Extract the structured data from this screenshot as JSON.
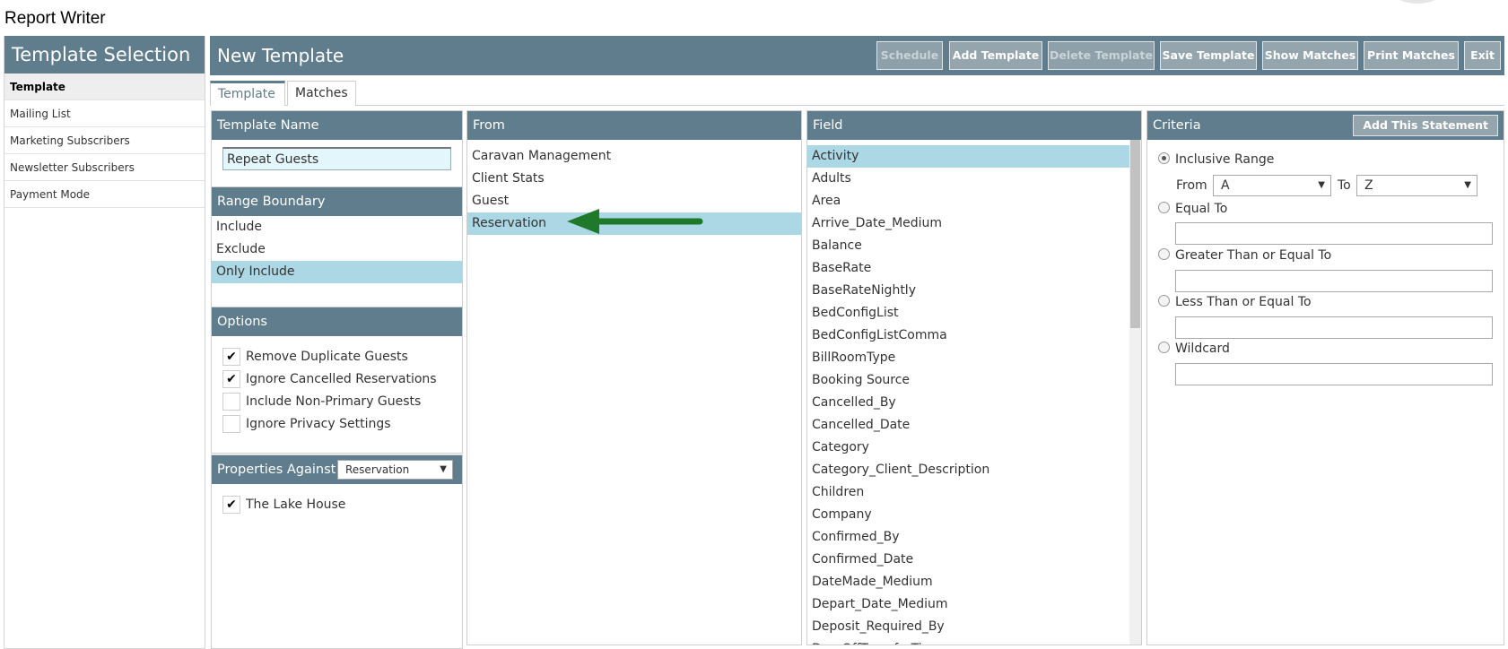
{
  "app": {
    "title": "Report Writer"
  },
  "sidebar": {
    "title": "Template Selection",
    "items": [
      {
        "label": "Template",
        "active": true
      },
      {
        "label": "Mailing List"
      },
      {
        "label": "Marketing Subscribers"
      },
      {
        "label": "Newsletter Subscribers"
      },
      {
        "label": "Payment Mode"
      }
    ]
  },
  "header": {
    "title": "New Template",
    "buttons": {
      "schedule": "Schedule",
      "add_template": "Add Template",
      "delete_template": "Delete Template",
      "save_template": "Save Template",
      "show_matches": "Show Matches",
      "print_matches": "Print Matches",
      "exit": "Exit"
    }
  },
  "tabs": {
    "template": "Template",
    "matches": "Matches"
  },
  "template_name": {
    "header": "Template Name",
    "value": "Repeat Guests"
  },
  "range_boundary": {
    "header": "Range Boundary",
    "items": [
      "Include",
      "Exclude",
      "Only Include"
    ],
    "selected": "Only Include"
  },
  "options": {
    "header": "Options",
    "items": [
      {
        "label": "Remove Duplicate Guests",
        "checked": true
      },
      {
        "label": "Ignore Cancelled Reservations",
        "checked": true
      },
      {
        "label": "Include Non-Primary Guests",
        "checked": false
      },
      {
        "label": "Ignore Privacy Settings",
        "checked": false
      }
    ]
  },
  "properties": {
    "header": "Properties Against",
    "selected": "Reservation",
    "items": [
      {
        "label": "The Lake House",
        "checked": true
      }
    ]
  },
  "from": {
    "header": "From",
    "items": [
      "Caravan Management",
      "Client Stats",
      "Guest",
      "Reservation"
    ],
    "selected": "Reservation"
  },
  "field": {
    "header": "Field",
    "selected": "Activity",
    "items": [
      "Activity",
      "Adults",
      "Area",
      "Arrive_Date_Medium",
      "Balance",
      "BaseRate",
      "BaseRateNightly",
      "BedConfigList",
      "BedConfigListComma",
      "BillRoomType",
      "Booking Source",
      "Cancelled_By",
      "Cancelled_Date",
      "Category",
      "Category_Client_Description",
      "Children",
      "Company",
      "Confirmed_By",
      "Confirmed_Date",
      "DateMade_Medium",
      "Depart_Date_Medium",
      "Deposit_Required_By",
      "DropOffTransferTime"
    ]
  },
  "criteria": {
    "header": "Criteria",
    "add_statement": "Add This Statement",
    "inclusive_range": "Inclusive Range",
    "from_label": "From",
    "from_value": "A",
    "to_label": "To",
    "to_value": "Z",
    "equal_to": "Equal To",
    "gte": "Greater Than or Equal To",
    "lte": "Less Than or Equal To",
    "wildcard": "Wildcard",
    "arrow_glyph": "▼",
    "check_glyph": "✔"
  },
  "colors": {
    "header_bg": "#5f7d8c",
    "selected_row": "#acd7e4",
    "button_bg": "#95a5ad",
    "arrow_green": "#1e7a2a"
  }
}
